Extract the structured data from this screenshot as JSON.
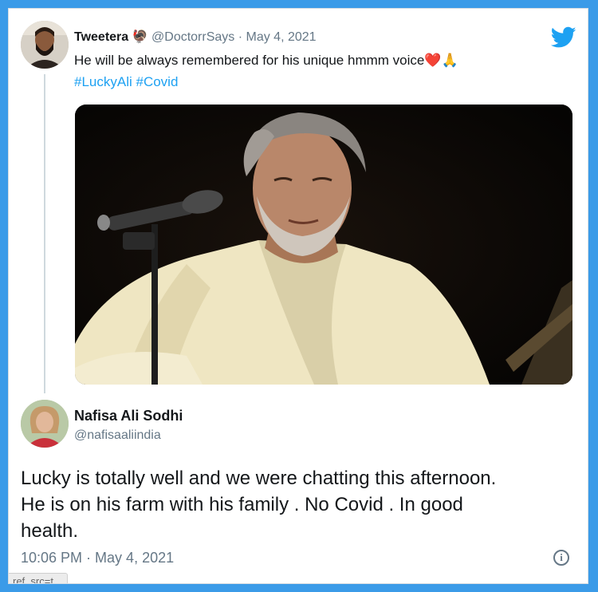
{
  "tweet1": {
    "display_name": "Tweetera",
    "name_emoji": "🦃",
    "handle": "@DoctorrSays",
    "separator": " · ",
    "date": "May 4, 2021",
    "text": "He will be always remembered for his unique hmmm voice",
    "emoji": "❤️🙏",
    "hashtags": [
      "#LuckyAli",
      "#Covid"
    ]
  },
  "brand_icon": "twitter-bird-icon",
  "tweet2": {
    "display_name": "Nafisa Ali Sodhi",
    "handle": "@nafisaaliindia",
    "text_lines": [
      "Lucky is totally well and we were chatting this afternoon.",
      "He is on his farm with his family . No Covid . In good",
      "health."
    ],
    "time": "10:06 PM",
    "separator": " · ",
    "date": "May 4, 2021"
  },
  "info_label": "i",
  "ref_label": "ref_src=t...",
  "colors": {
    "frame": "#3b9be8",
    "accent": "#1da1f2",
    "text": "#14171a",
    "muted": "#657786"
  }
}
